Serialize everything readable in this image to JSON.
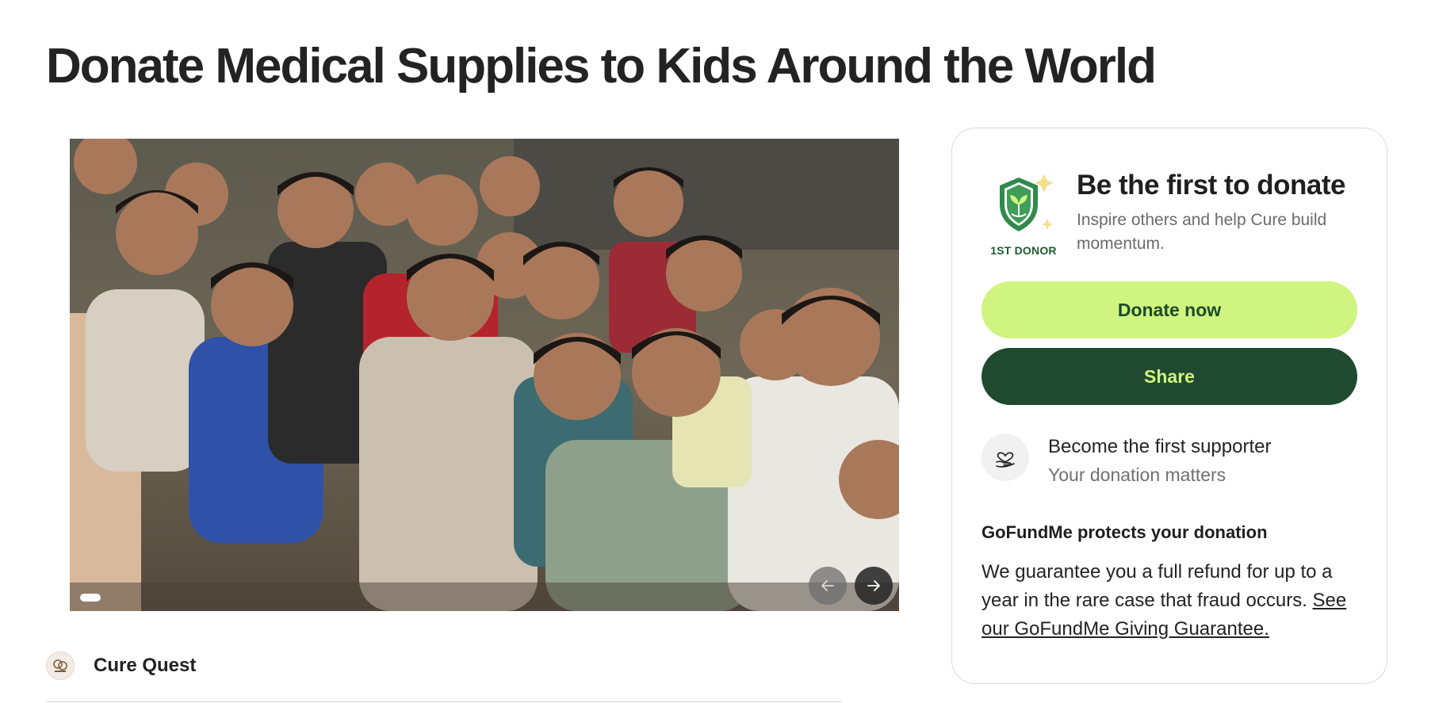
{
  "page": {
    "title": "Donate Medical Supplies to Kids Around the World"
  },
  "media": {
    "image_alt": "Group of smiling children",
    "prev_icon": "arrow-left-icon",
    "next_icon": "arrow-right-icon"
  },
  "organizer": {
    "name": "Cure Quest",
    "avatar_icon": "organization-logo-icon"
  },
  "card": {
    "badge_label": "1ST DONOR",
    "badge_icon": "shield-plant-icon",
    "title": "Be the first to donate",
    "subtitle": "Inspire others and help Cure build momentum.",
    "donate_label": "Donate now",
    "share_label": "Share",
    "supporter": {
      "icon": "heart-hand-icon",
      "title": "Become the first supporter",
      "subtitle": "Your donation matters"
    },
    "protection": {
      "title": "GoFundMe protects your donation",
      "body": "We guarantee you a full refund for up to a year in the rare case that fraud occurs.",
      "link": "See our GoFundMe Giving Guarantee."
    }
  },
  "colors": {
    "accent_green": "#cff47f",
    "dark_green": "#1f4a2f",
    "text": "#1f1f1f"
  }
}
